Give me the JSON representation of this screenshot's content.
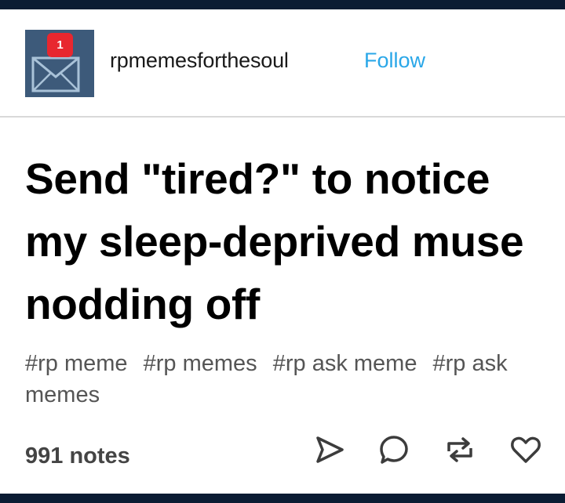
{
  "post": {
    "username": "rpmemesforthesoul",
    "follow_label": "Follow",
    "avatar": {
      "badge_count": "1",
      "icon": "envelope-icon",
      "background_color": "#3d5a7a",
      "badge_color": "#e8272f"
    },
    "title": "Send \"tired?\" to notice my sleep-deprived muse nodding off",
    "tags": [
      "#rp meme",
      "#rp memes",
      "#rp ask meme",
      "#rp ask memes"
    ],
    "notes_label": "991 notes",
    "actions": [
      {
        "icon": "share-icon"
      },
      {
        "icon": "comment-icon"
      },
      {
        "icon": "reblog-icon"
      },
      {
        "icon": "heart-icon"
      }
    ]
  },
  "colors": {
    "frame": "#0b1c33",
    "follow": "#2aa7e8",
    "divider": "#d9d9d9",
    "tag_text": "#555555"
  }
}
